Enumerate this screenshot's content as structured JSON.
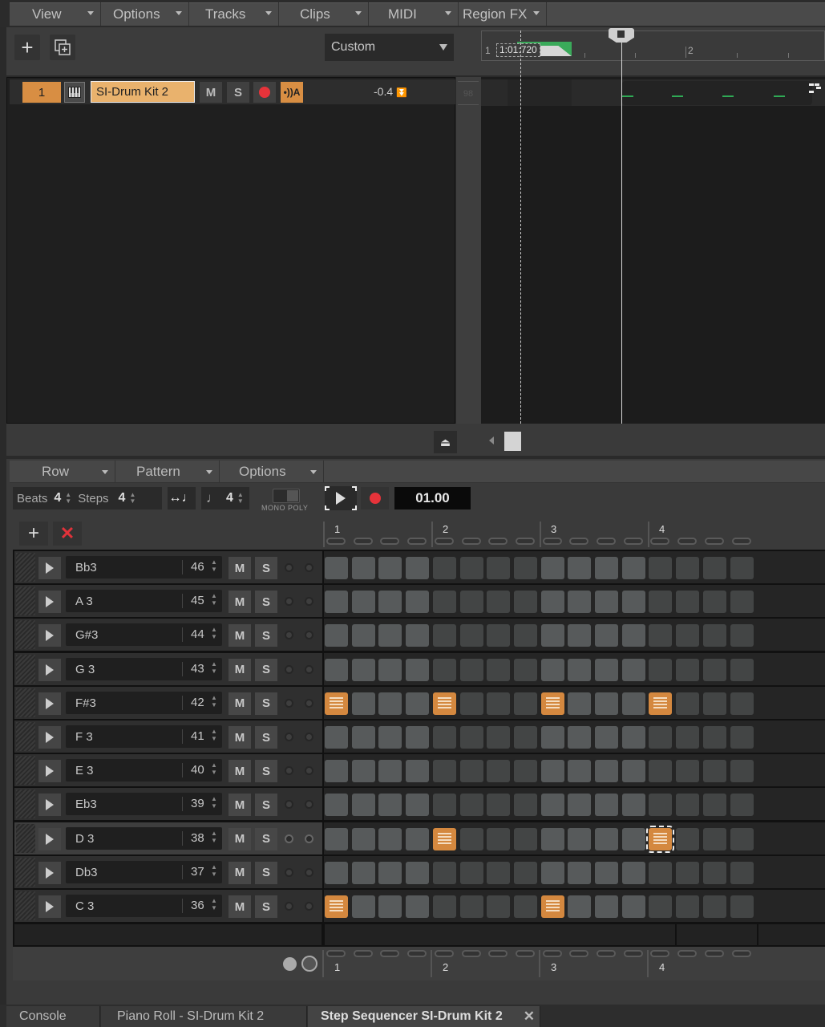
{
  "top_menu": [
    {
      "label": "View"
    },
    {
      "label": "Options"
    },
    {
      "label": "Tracks"
    },
    {
      "label": "Clips"
    },
    {
      "label": "MIDI"
    },
    {
      "label": "Region FX"
    }
  ],
  "toolbar": {
    "add_track_icon": "plus-icon",
    "duplicate_icon": "duplicate-icon",
    "layout_select": "Custom"
  },
  "timeline": {
    "bar_labels": [
      "1",
      "2"
    ],
    "time_readout": "1:01:720"
  },
  "track": {
    "number": "1",
    "name": "SI-Drum Kit 2",
    "mute": "M",
    "solo": "S",
    "volume": "-0.4",
    "side_label": "98"
  },
  "step_sequencer": {
    "menus": [
      {
        "label": "Row"
      },
      {
        "label": "Pattern"
      },
      {
        "label": "Options"
      }
    ],
    "beats_label": "Beats",
    "beats_value": "4",
    "steps_label": "Steps",
    "steps_value": "4",
    "note_value": "4",
    "mono_label": "MONO",
    "poly_label": "POLY",
    "position": "01.00",
    "beat_labels": [
      "1",
      "2",
      "3",
      "4"
    ],
    "rows": [
      {
        "note": "Bb3",
        "number": "46",
        "steps": [
          0,
          0,
          0,
          0,
          0,
          0,
          0,
          0,
          0,
          0,
          0,
          0,
          0,
          0,
          0,
          0
        ]
      },
      {
        "note": "A 3",
        "number": "45",
        "steps": [
          0,
          0,
          0,
          0,
          0,
          0,
          0,
          0,
          0,
          0,
          0,
          0,
          0,
          0,
          0,
          0
        ]
      },
      {
        "note": "G#3",
        "number": "44",
        "steps": [
          0,
          0,
          0,
          0,
          0,
          0,
          0,
          0,
          0,
          0,
          0,
          0,
          0,
          0,
          0,
          0
        ]
      },
      {
        "note": "G 3",
        "number": "43",
        "steps": [
          0,
          0,
          0,
          0,
          0,
          0,
          0,
          0,
          0,
          0,
          0,
          0,
          0,
          0,
          0,
          0
        ]
      },
      {
        "note": "F#3",
        "number": "42",
        "steps": [
          1,
          0,
          0,
          0,
          1,
          0,
          0,
          0,
          1,
          0,
          0,
          0,
          1,
          0,
          0,
          0
        ]
      },
      {
        "note": "F 3",
        "number": "41",
        "steps": [
          0,
          0,
          0,
          0,
          0,
          0,
          0,
          0,
          0,
          0,
          0,
          0,
          0,
          0,
          0,
          0
        ]
      },
      {
        "note": "E 3",
        "number": "40",
        "steps": [
          0,
          0,
          0,
          0,
          0,
          0,
          0,
          0,
          0,
          0,
          0,
          0,
          0,
          0,
          0,
          0
        ]
      },
      {
        "note": "Eb3",
        "number": "39",
        "steps": [
          0,
          0,
          0,
          0,
          0,
          0,
          0,
          0,
          0,
          0,
          0,
          0,
          0,
          0,
          0,
          0
        ]
      },
      {
        "note": "D 3",
        "number": "38",
        "steps": [
          0,
          0,
          0,
          0,
          1,
          0,
          0,
          0,
          0,
          0,
          0,
          0,
          1,
          0,
          0,
          0
        ],
        "highlight": true,
        "selected_step": 12
      },
      {
        "note": "Db3",
        "number": "37",
        "steps": [
          0,
          0,
          0,
          0,
          0,
          0,
          0,
          0,
          0,
          0,
          0,
          0,
          0,
          0,
          0,
          0
        ]
      },
      {
        "note": "C 3",
        "number": "36",
        "steps": [
          1,
          0,
          0,
          0,
          0,
          0,
          0,
          0,
          1,
          0,
          0,
          0,
          0,
          0,
          0,
          0
        ]
      }
    ],
    "mute_label": "M",
    "solo_label": "S"
  },
  "tabs": [
    {
      "label": "Console"
    },
    {
      "label": "Piano Roll - SI-Drum Kit 2"
    },
    {
      "label": "Step Sequencer SI-Drum Kit 2",
      "active": true,
      "close": "✕"
    }
  ],
  "colors": {
    "accent_orange": "#d4883f",
    "track_name_bg": "#e9b26d",
    "record_red": "#e6333a",
    "note_green": "#2faa55"
  }
}
